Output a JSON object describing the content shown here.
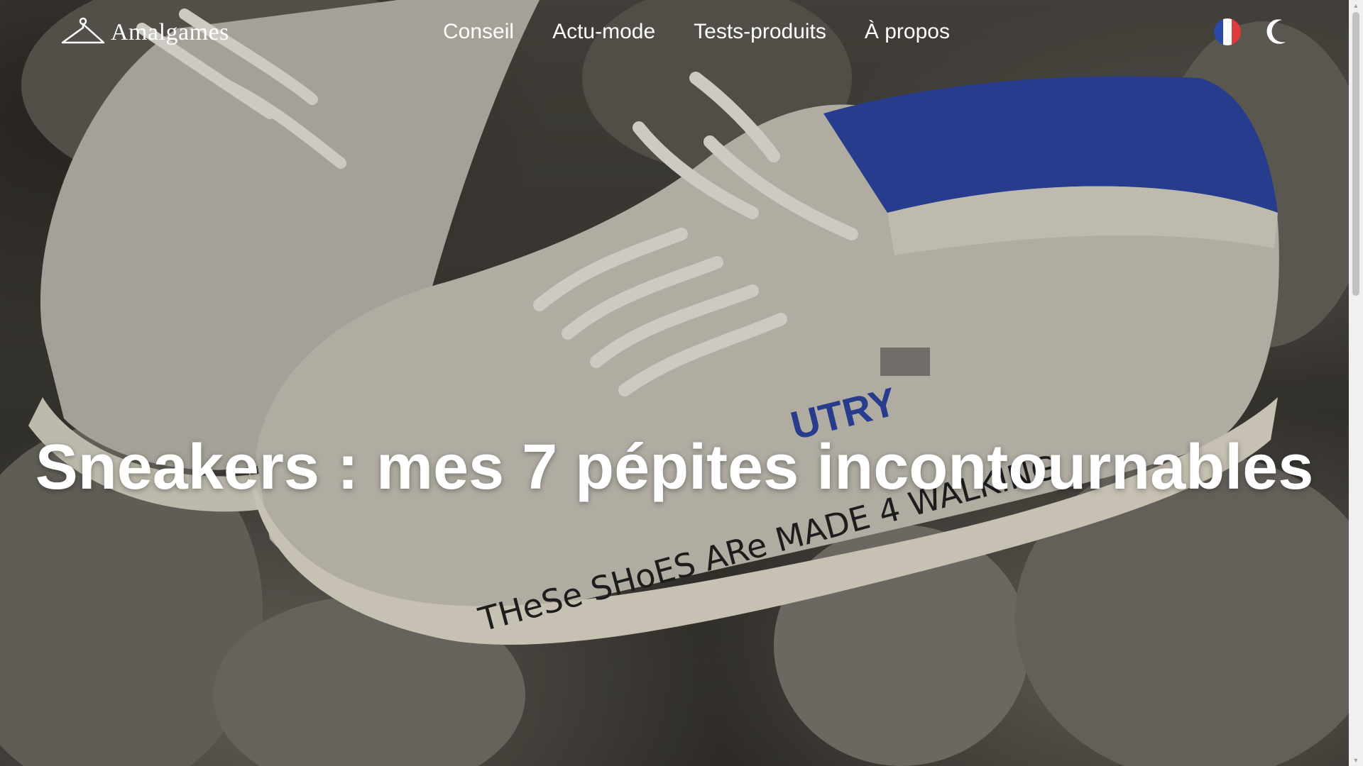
{
  "header": {
    "logo_text": "Amalgames",
    "logo_icon": "hanger-icon",
    "nav": [
      {
        "label": "Conseil"
      },
      {
        "label": "Actu-mode"
      },
      {
        "label": "Tests-produits"
      },
      {
        "label": "À propos"
      }
    ],
    "language_icon": "french-flag-icon",
    "theme_toggle_icon": "moon-icon"
  },
  "hero": {
    "title": "Sneakers : mes 7 pépites incontournables",
    "image_text": "THeSe SHoES ARe MADE 4 WALKING"
  },
  "colors": {
    "flag_blue": "#2b4aa8",
    "flag_white": "#ffffff",
    "flag_red": "#e03a3e",
    "text": "#ffffff"
  }
}
